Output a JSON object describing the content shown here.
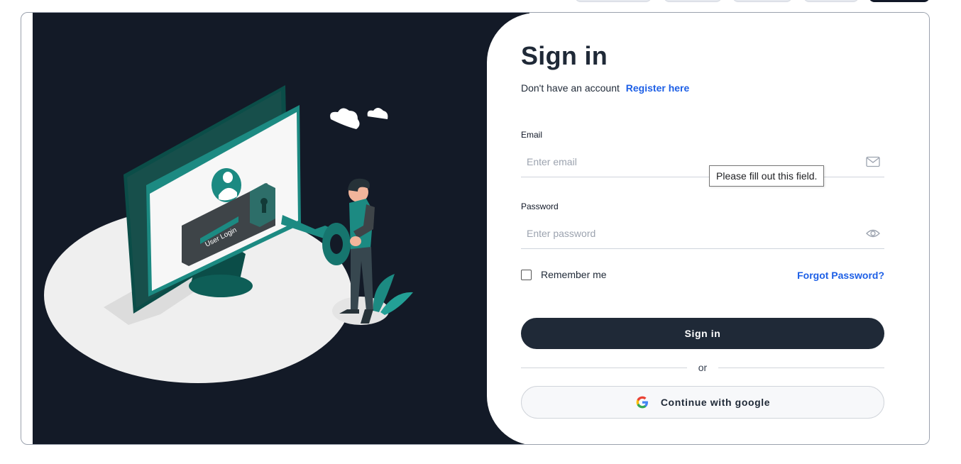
{
  "hero": {
    "illustration_text": "User Login"
  },
  "form": {
    "title": "Sign in",
    "no_account_text": "Don't have an account",
    "register_link": "Register here",
    "email": {
      "label": "Email",
      "placeholder": "Enter email",
      "value": "",
      "icon": "mail-icon"
    },
    "validation_tooltip": "Please fill out this field.",
    "password": {
      "label": "Password",
      "placeholder": "Enter password",
      "value": "",
      "icon": "eye-icon"
    },
    "remember_label": "Remember me",
    "remember_checked": false,
    "forgot_link": "Forgot Password?",
    "submit_label": "Sign in",
    "divider_text": "or",
    "google_label": "Continue with google"
  },
  "colors": {
    "accent": "#1d5fe6",
    "primary_button": "#1f2937",
    "hero_background": "#131a27",
    "illustration_teal": "#1c8a82"
  }
}
